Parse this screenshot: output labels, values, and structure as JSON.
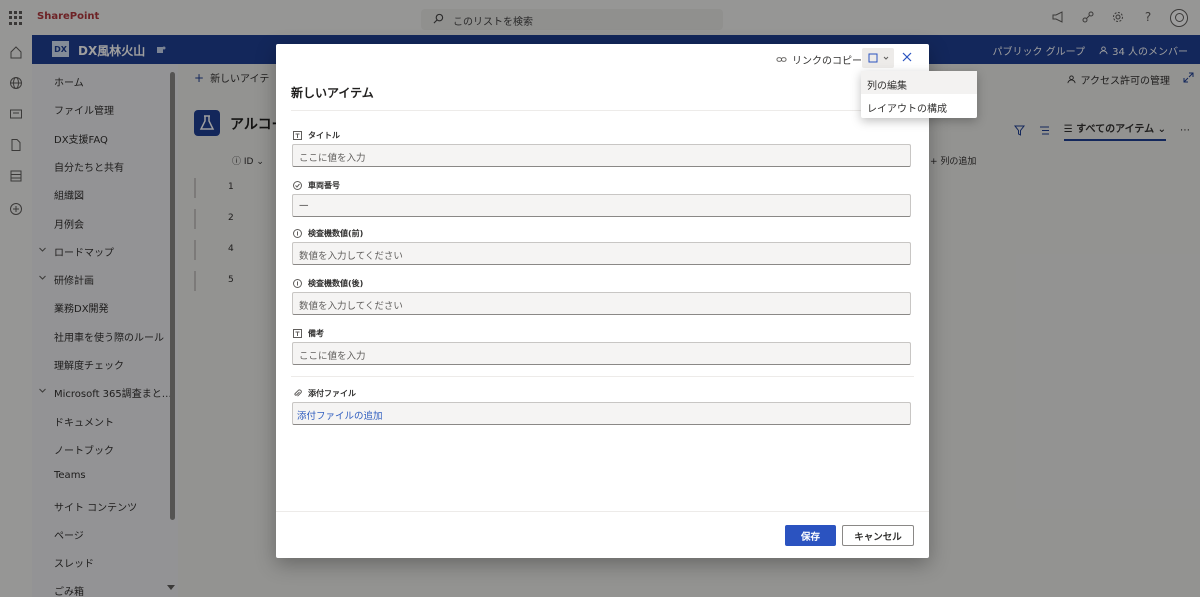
{
  "suite": {
    "brand": "SharePoint",
    "search_placeholder": "このリストを検索",
    "icons": [
      "megaphone-icon",
      "share-icon",
      "settings-icon",
      "help-icon",
      "user-avatar-icon"
    ]
  },
  "site": {
    "logo": "DX",
    "name": "DX風林火山",
    "visibility": "パブリック グループ",
    "members": "34 人のメンバー"
  },
  "nav": {
    "items": [
      {
        "label": "ホーム",
        "expand": false
      },
      {
        "label": "ファイル管理",
        "expand": false
      },
      {
        "label": "DX支援FAQ",
        "expand": false
      },
      {
        "label": "自分たちと共有",
        "expand": false
      },
      {
        "label": "組織図",
        "expand": false
      },
      {
        "label": "月例会",
        "expand": false
      },
      {
        "label": "ロードマップ",
        "expand": true
      },
      {
        "label": "研修計画",
        "expand": true
      },
      {
        "label": "業務DX開発",
        "expand": false
      },
      {
        "label": "社用車を使う際のルール",
        "expand": false
      },
      {
        "label": "理解度チェック",
        "expand": false
      },
      {
        "label": "Microsoft 365調査まと…",
        "expand": true
      },
      {
        "label": "ドキュメント",
        "expand": false
      },
      {
        "label": "ノートブック",
        "expand": false
      },
      {
        "label": "Teams",
        "expand": false
      },
      {
        "label": "サイト コンテンツ",
        "expand": false
      },
      {
        "label": "ページ",
        "expand": false
      },
      {
        "label": "スレッド",
        "expand": false
      },
      {
        "label": "ごみ箱",
        "expand": false
      }
    ]
  },
  "list": {
    "new_item": "新しいアイテ",
    "access": "アクセス許可の管理",
    "title": "アルコー",
    "view_name": "すべてのアイテム",
    "col_id": "ID",
    "col_add": "列の追加",
    "rows": [
      "1",
      "2",
      "4",
      "5"
    ]
  },
  "dialog": {
    "copy_link": "リンクのコピー",
    "title": "新しいアイテム",
    "fields": [
      {
        "label": "タイトル",
        "value": "ここに値を入力",
        "icon": "text-field-icon"
      },
      {
        "label": "車両番号",
        "value": "—",
        "icon": "check-circle-icon"
      },
      {
        "label": "検査機数値(前)",
        "value": "数値を入力してください",
        "icon": "number-field-icon"
      },
      {
        "label": "検査機数値(後)",
        "value": "数値を入力してください",
        "icon": "number-field-icon"
      },
      {
        "label": "備考",
        "value": "ここに値を入力",
        "icon": "text-field-icon"
      }
    ],
    "attachment_label": "添付ファイル",
    "attachment_link": "添付ファイルの追加",
    "save": "保存",
    "cancel": "キャンセル"
  },
  "dropdown": {
    "items": [
      "列の編集",
      "レイアウトの構成"
    ]
  }
}
